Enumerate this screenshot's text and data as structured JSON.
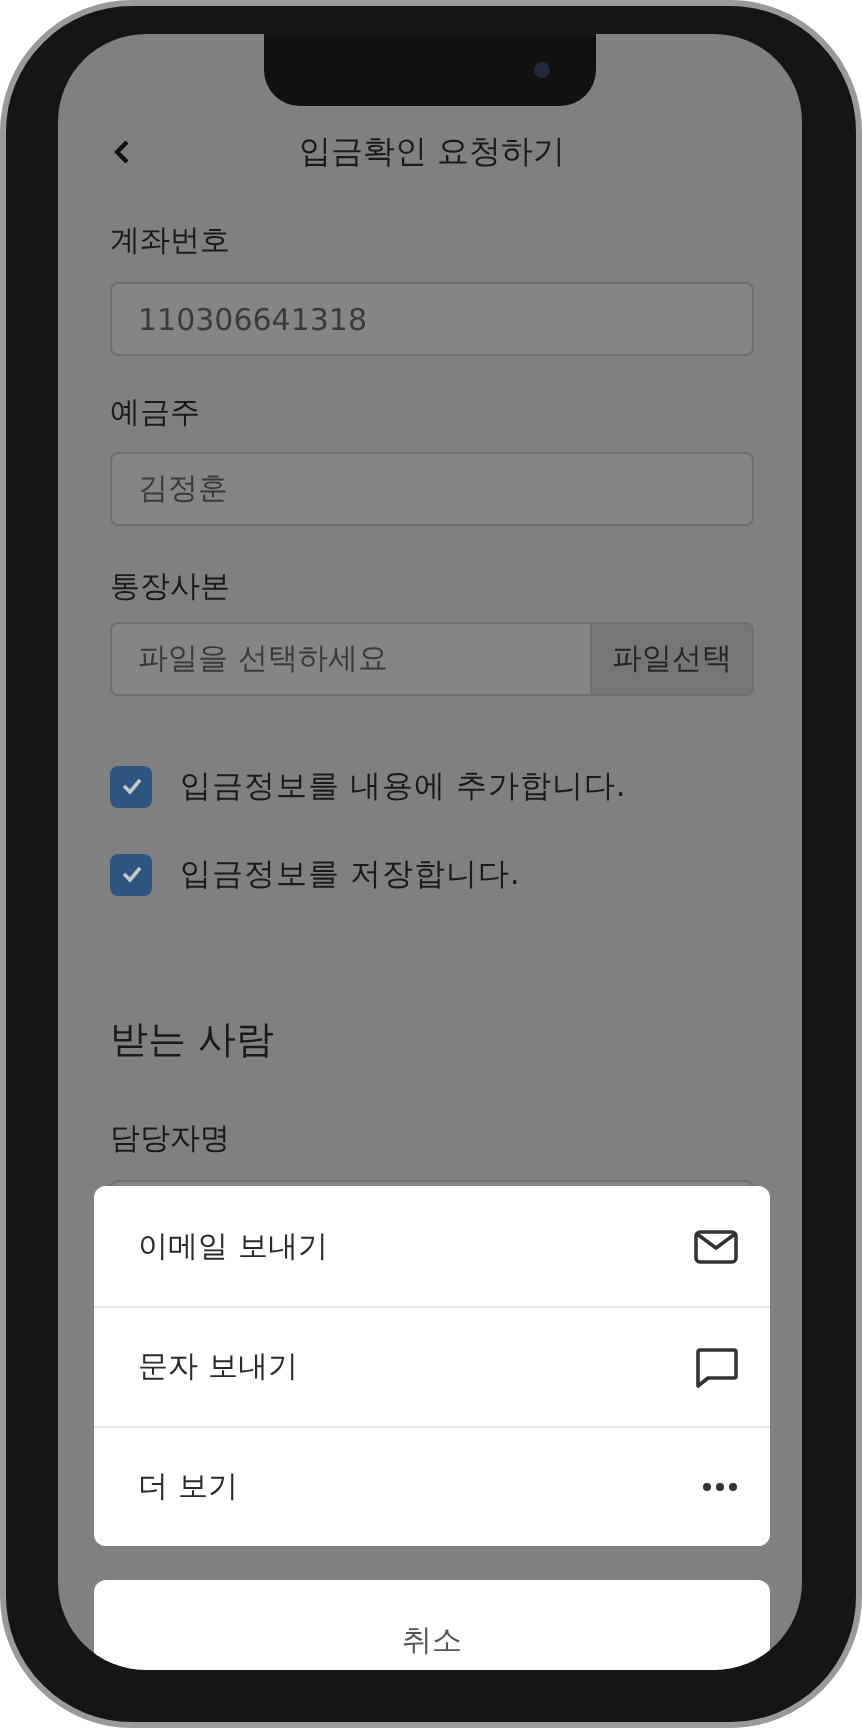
{
  "header": {
    "title": "입금확인 요청하기"
  },
  "fields": [
    {
      "kind": "text",
      "label": "계좌번호",
      "value": "110306641318"
    },
    {
      "kind": "text",
      "label": "예금주",
      "value": "김정훈"
    },
    {
      "kind": "file",
      "label": "통장사본",
      "placeholder": "파일을 선택하세요",
      "button": "파일선택"
    }
  ],
  "checkboxes": [
    {
      "label": "입금정보를 내용에 추가합니다.",
      "checked": true
    },
    {
      "label": "입금정보를 저장합니다.",
      "checked": true
    }
  ],
  "recipient": {
    "title": "받는 사람",
    "label": "담당자명"
  },
  "action_sheet": {
    "actions": [
      {
        "kind": "mail",
        "label": "이메일 보내기"
      },
      {
        "kind": "message",
        "label": "문자 보내기"
      },
      {
        "kind": "more",
        "label": "더 보기"
      }
    ],
    "cancel": "취소"
  }
}
